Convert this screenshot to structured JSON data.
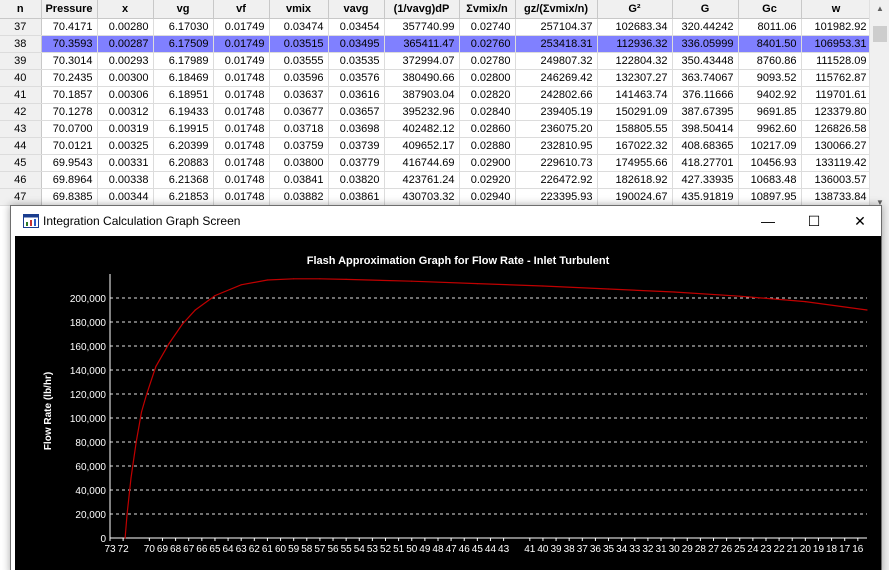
{
  "grid": {
    "columns": [
      "n",
      "Pressure",
      "x",
      "vg",
      "vf",
      "vmix",
      "vavg",
      "(1/vavg)dP",
      "Σvmix/n",
      "gz/(Σvmix/n)",
      "G²",
      "G",
      "Gc",
      "w"
    ],
    "selected_n": "38",
    "rows": [
      [
        "37",
        "70.4171",
        "0.00280",
        "6.17030",
        "0.01749",
        "0.03474",
        "0.03454",
        "357740.99",
        "0.02740",
        "257104.37",
        "102683.34",
        "320.44242",
        "8011.06",
        "101982.92"
      ],
      [
        "38",
        "70.3593",
        "0.00287",
        "6.17509",
        "0.01749",
        "0.03515",
        "0.03495",
        "365411.47",
        "0.02760",
        "253418.31",
        "112936.32",
        "336.05999",
        "8401.50",
        "106953.31"
      ],
      [
        "39",
        "70.3014",
        "0.00293",
        "6.17989",
        "0.01749",
        "0.03555",
        "0.03535",
        "372994.07",
        "0.02780",
        "249807.32",
        "122804.32",
        "350.43448",
        "8760.86",
        "111528.09"
      ],
      [
        "40",
        "70.2435",
        "0.00300",
        "6.18469",
        "0.01748",
        "0.03596",
        "0.03576",
        "380490.66",
        "0.02800",
        "246269.42",
        "132307.27",
        "363.74067",
        "9093.52",
        "115762.87"
      ],
      [
        "41",
        "70.1857",
        "0.00306",
        "6.18951",
        "0.01748",
        "0.03637",
        "0.03616",
        "387903.04",
        "0.02820",
        "242802.66",
        "141463.74",
        "376.11666",
        "9402.92",
        "119701.61"
      ],
      [
        "42",
        "70.1278",
        "0.00312",
        "6.19433",
        "0.01748",
        "0.03677",
        "0.03657",
        "395232.96",
        "0.02840",
        "239405.19",
        "150291.09",
        "387.67395",
        "9691.85",
        "123379.80"
      ],
      [
        "43",
        "70.0700",
        "0.00319",
        "6.19915",
        "0.01748",
        "0.03718",
        "0.03698",
        "402482.12",
        "0.02860",
        "236075.20",
        "158805.55",
        "398.50414",
        "9962.60",
        "126826.58"
      ],
      [
        "44",
        "70.0121",
        "0.00325",
        "6.20399",
        "0.01748",
        "0.03759",
        "0.03739",
        "409652.17",
        "0.02880",
        "232810.95",
        "167022.32",
        "408.68365",
        "10217.09",
        "130066.27"
      ],
      [
        "45",
        "69.9543",
        "0.00331",
        "6.20883",
        "0.01748",
        "0.03800",
        "0.03779",
        "416744.69",
        "0.02900",
        "229610.73",
        "174955.66",
        "418.27701",
        "10456.93",
        "133119.42"
      ],
      [
        "46",
        "69.8964",
        "0.00338",
        "6.21368",
        "0.01748",
        "0.03841",
        "0.03820",
        "423761.24",
        "0.02920",
        "226472.92",
        "182618.92",
        "427.33935",
        "10683.48",
        "136003.57"
      ],
      [
        "47",
        "69.8385",
        "0.00344",
        "6.21853",
        "0.01748",
        "0.03882",
        "0.03861",
        "430703.32",
        "0.02940",
        "223395.93",
        "190024.67",
        "435.91819",
        "10897.95",
        "138733.84"
      ]
    ]
  },
  "window": {
    "title": "Integration Calculation Graph Screen",
    "minimize_glyph": "—",
    "maximize_glyph": "☐",
    "close_glyph": "✕"
  },
  "chart_data": {
    "type": "line",
    "title": "Flash Approximation Graph for Flow Rate - Inlet Turbulent",
    "xlabel": "",
    "ylabel": "Flow Rate (lb/hr)",
    "xlim": [
      73,
      15.3
    ],
    "ylim": [
      0,
      220000
    ],
    "x_ticks": [
      73,
      72,
      70,
      69,
      68,
      67,
      66,
      65,
      64,
      63,
      62,
      61,
      60,
      59,
      58,
      57,
      56,
      55,
      54,
      53,
      52,
      51,
      50,
      49,
      48,
      47,
      46,
      45,
      44,
      43,
      41,
      40,
      39,
      38,
      37,
      36,
      35,
      34,
      33,
      32,
      31,
      30,
      29,
      28,
      27,
      26,
      25,
      24,
      23,
      22,
      21,
      20,
      19,
      18,
      17,
      16
    ],
    "y_ticks": [
      0,
      20000,
      40000,
      60000,
      80000,
      100000,
      120000,
      140000,
      160000,
      180000,
      200000
    ],
    "y_tick_labels": [
      "0",
      "20,000",
      "40,000",
      "60,000",
      "80,000",
      "100,000",
      "120,000",
      "140,000",
      "160,000",
      "180,000",
      "200,000"
    ],
    "grid": true,
    "line_color": "#c00000",
    "series": [
      {
        "x": [
          71.85,
          71.7,
          71.4,
          71.0,
          70.6,
          70.2,
          69.5,
          68.5,
          67.5,
          66.5,
          65.0,
          63.0,
          61.0,
          59.0,
          57.0,
          55.0,
          50.0,
          45.0,
          40.0,
          35.0,
          30.0,
          25.0,
          20.0,
          15.3
        ],
        "values": [
          0,
          20000,
          50000,
          80000,
          105000,
          120000,
          143000,
          162000,
          178000,
          190000,
          202000,
          211000,
          215000,
          216000,
          216000,
          215500,
          214000,
          212000,
          210000,
          207500,
          205000,
          201500,
          197000,
          190000
        ]
      }
    ]
  }
}
